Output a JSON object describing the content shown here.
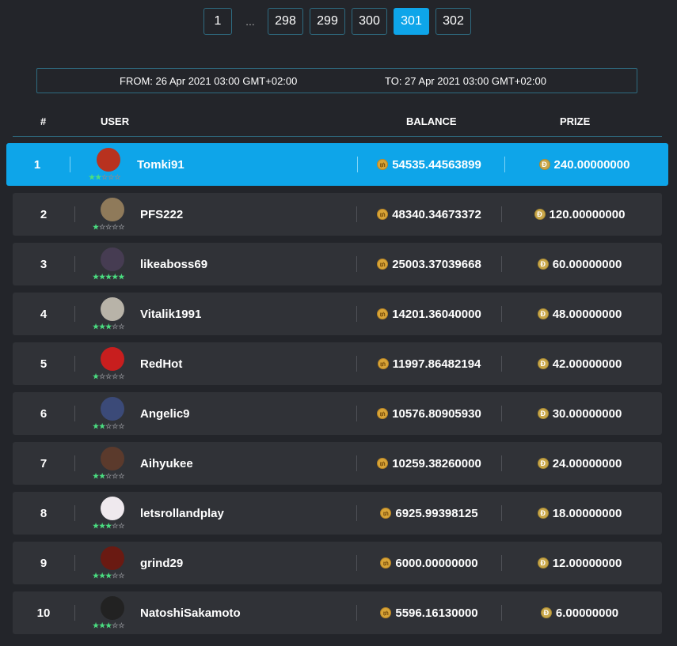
{
  "pagination": {
    "pages": [
      {
        "label": "1",
        "active": false
      },
      {
        "label": "298",
        "active": false
      },
      {
        "label": "299",
        "active": false
      },
      {
        "label": "300",
        "active": false
      },
      {
        "label": "301",
        "active": true
      },
      {
        "label": "302",
        "active": false
      }
    ],
    "ellipsis": "..."
  },
  "range": {
    "from": "FROM: 26 Apr 2021 03:00 GMT+02:00",
    "to": "TO: 27 Apr 2021 03:00 GMT+02:00"
  },
  "columns": {
    "rank": "#",
    "user": "USER",
    "balance": "BALANCE",
    "prize": "PRIZE"
  },
  "colors": {
    "accent": "#0ea5e9",
    "row_bg": "#303237",
    "page_bg": "#23252a",
    "star_on": "#4ade80"
  },
  "rows": [
    {
      "rank": "1",
      "user": "Tomki91",
      "stars": 2,
      "balance": "54535.44563899",
      "prize": "240.00000000",
      "avatar": "avatar-tomki91",
      "avatar_color": "#b8321f",
      "highlighted": true
    },
    {
      "rank": "2",
      "user": "PFS222",
      "stars": 1,
      "balance": "48340.34673372",
      "prize": "120.00000000",
      "avatar": "avatar-pfs222",
      "avatar_color": "#8f7a5a"
    },
    {
      "rank": "3",
      "user": "likeaboss69",
      "stars": 5,
      "balance": "25003.37039668",
      "prize": "60.00000000",
      "avatar": "avatar-likeaboss69",
      "avatar_color": "#463c52"
    },
    {
      "rank": "4",
      "user": "Vitalik1991",
      "stars": 3,
      "balance": "14201.36040000",
      "prize": "48.00000000",
      "avatar": "avatar-vitalik1991",
      "avatar_color": "#b8b3a8"
    },
    {
      "rank": "5",
      "user": "RedHot",
      "stars": 1,
      "balance": "11997.86482194",
      "prize": "42.00000000",
      "avatar": "avatar-redhot",
      "avatar_color": "#c81e1e"
    },
    {
      "rank": "6",
      "user": "Angelic9",
      "stars": 2,
      "balance": "10576.80905930",
      "prize": "30.00000000",
      "avatar": "avatar-angelic9",
      "avatar_color": "#3b4a78"
    },
    {
      "rank": "7",
      "user": "Aihyukee",
      "stars": 2,
      "balance": "10259.38260000",
      "prize": "24.00000000",
      "avatar": "avatar-aihyukee",
      "avatar_color": "#5b3a2c"
    },
    {
      "rank": "8",
      "user": "letsrollandplay",
      "stars": 3,
      "balance": "6925.99398125",
      "prize": "18.00000000",
      "avatar": "avatar-letsrollandplay",
      "avatar_color": "#efe9ee"
    },
    {
      "rank": "9",
      "user": "grind29",
      "stars": 3,
      "balance": "6000.00000000",
      "prize": "12.00000000",
      "avatar": "avatar-grind29",
      "avatar_color": "#6a1a12"
    },
    {
      "rank": "10",
      "user": "NatoshiSakamoto",
      "stars": 3,
      "balance": "5596.16130000",
      "prize": "6.00000000",
      "avatar": "avatar-natoshisakamoto",
      "avatar_color": "#222222"
    }
  ]
}
